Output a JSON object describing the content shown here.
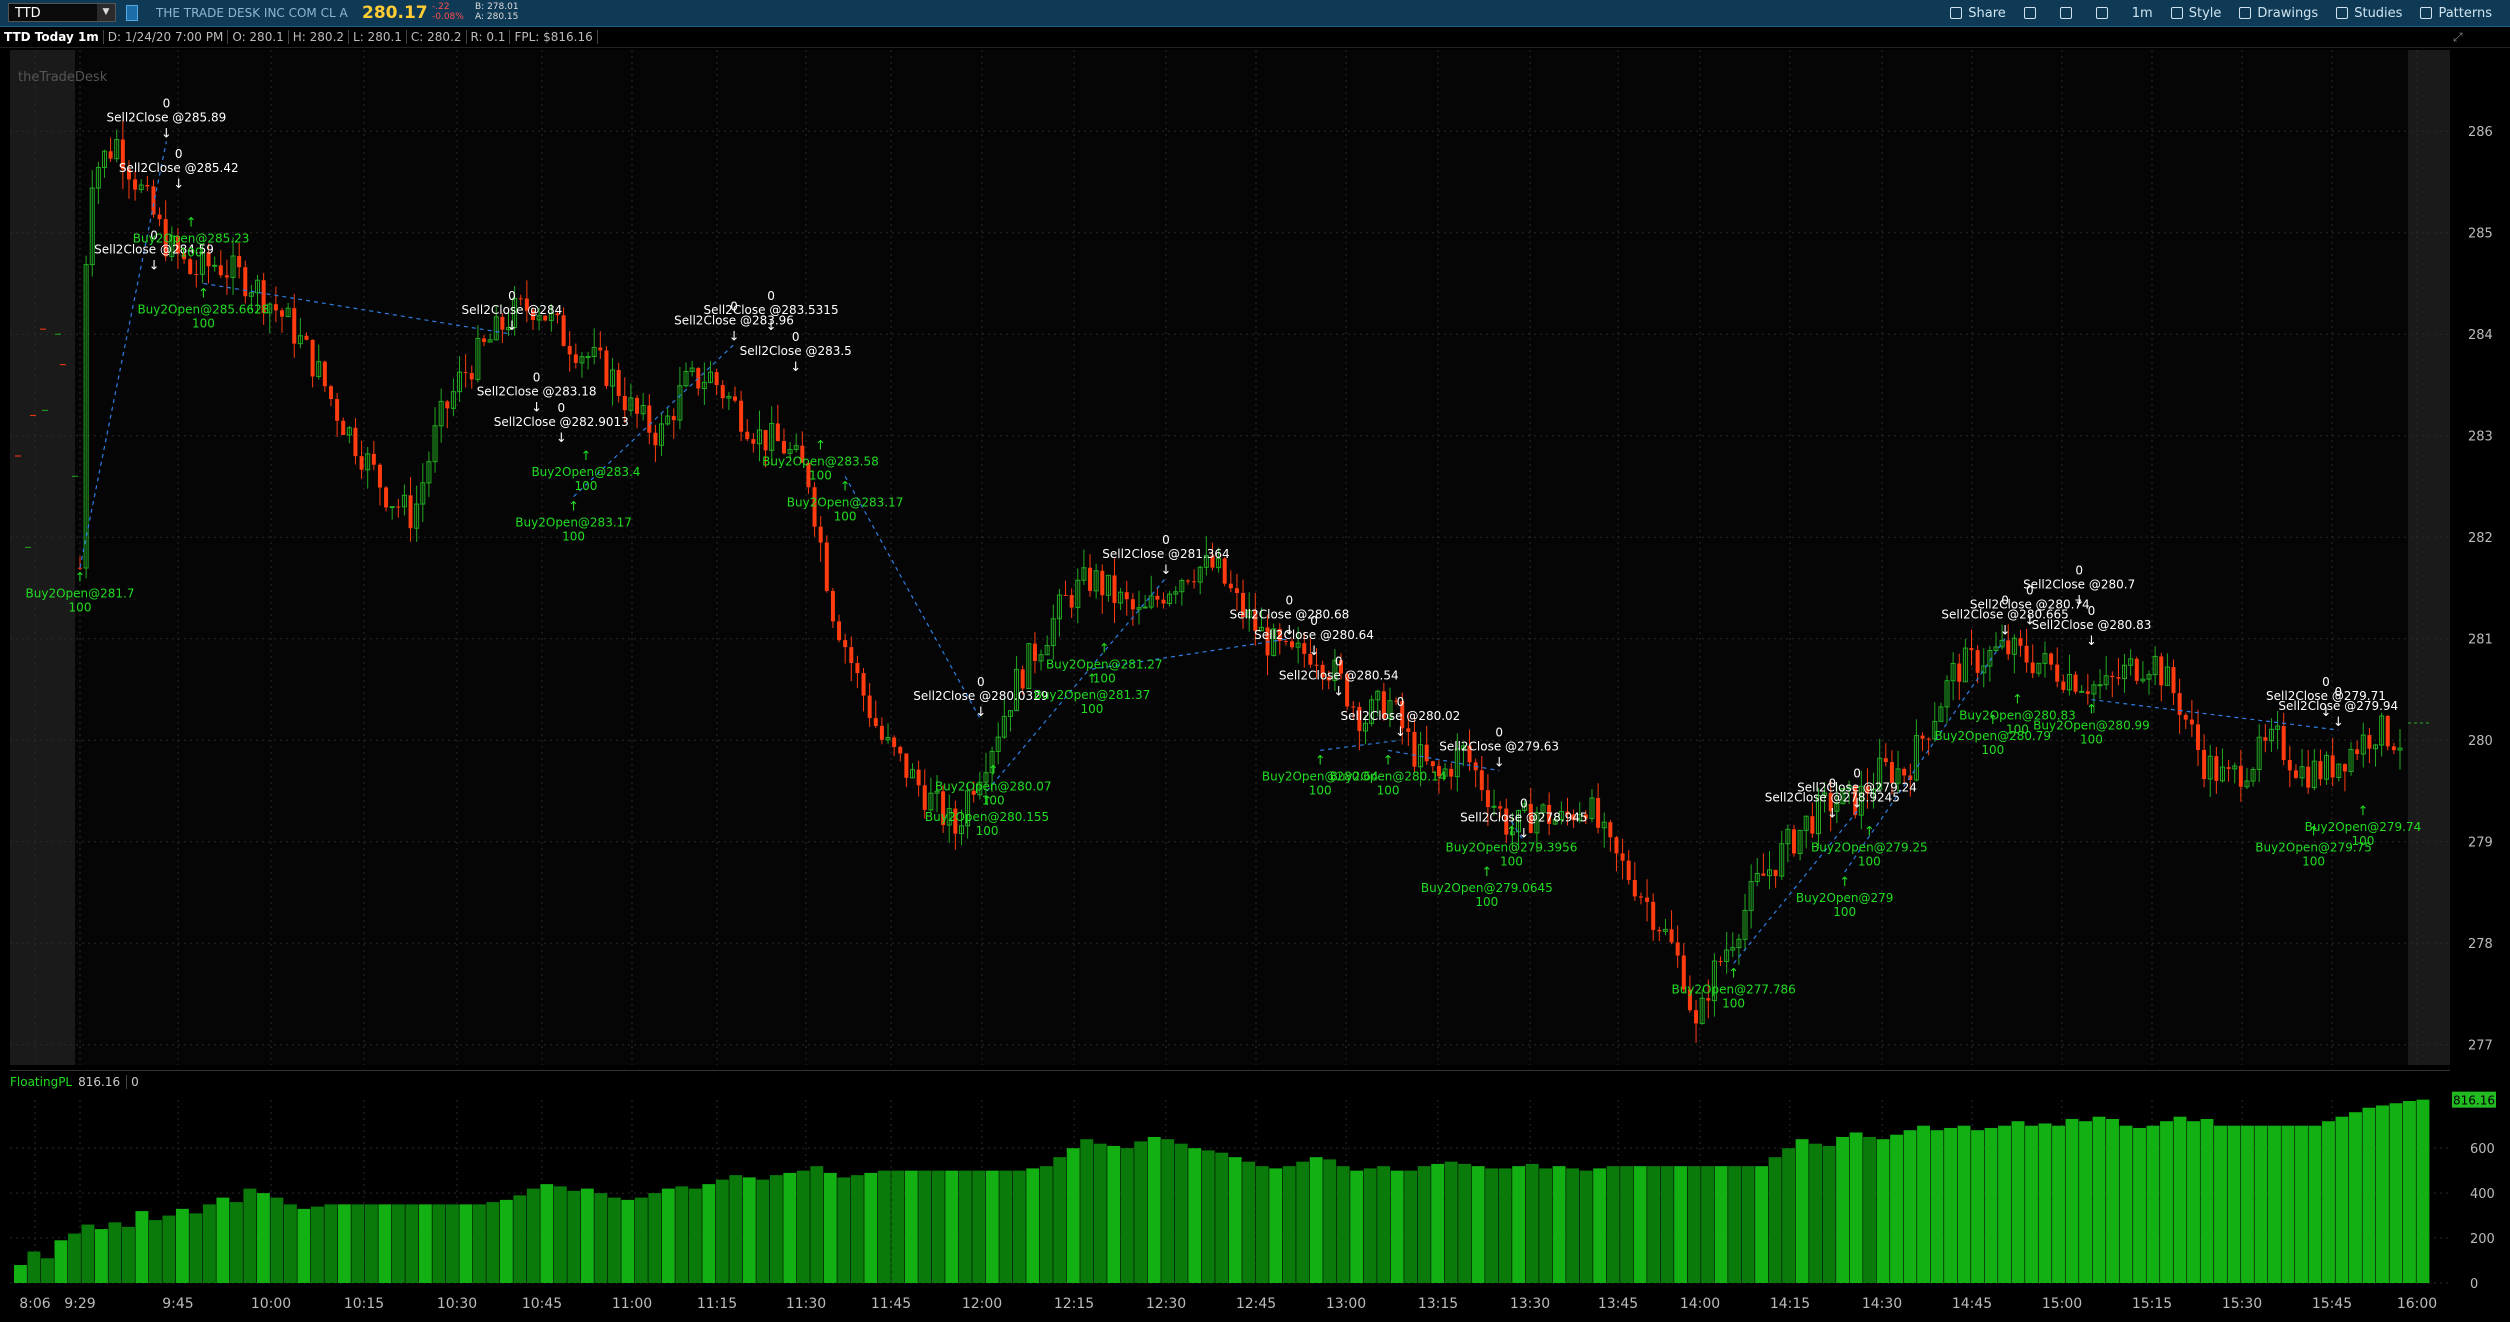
{
  "header": {
    "symbol": "TTD",
    "company": "THE TRADE DESK INC COM CL A",
    "last": "280.17",
    "change": "-.22",
    "change_pct": "-0.08%",
    "bid": "B: 278.01",
    "ask": "A: 280.15"
  },
  "toolbar": [
    {
      "label": "Share",
      "icon": "share-icon"
    },
    {
      "label": "",
      "icon": "camera-icon"
    },
    {
      "label": "",
      "icon": "flask-icon"
    },
    {
      "label": "",
      "icon": "gear-icon"
    },
    {
      "label": "1m",
      "icon": ""
    },
    {
      "label": "Style",
      "icon": "style-icon"
    },
    {
      "label": "Drawings",
      "icon": "drawings-icon"
    },
    {
      "label": "Studies",
      "icon": "studies-icon"
    },
    {
      "label": "Patterns",
      "icon": "patterns-icon"
    }
  ],
  "info": {
    "title": "TTD Today 1m",
    "date": "D: 1/24/20 7:00 PM",
    "open": "O: 280.1",
    "high": "H: 280.2",
    "low": "L: 280.1",
    "close": "C: 280.2",
    "range": "R: 0.1",
    "fpl": "FPL: $816.16"
  },
  "watermark": "theTradeDesk",
  "fpl_panel": {
    "name": "FloatingPL",
    "value": "816.16",
    "zero": "0"
  },
  "colors": {
    "up": "#22aa22",
    "down": "#ff3b10",
    "buy": "#22dd22",
    "sell": "#ffffff",
    "bar": "#0a7a0a"
  },
  "chart_data": [
    {
      "type": "candlestick",
      "title": "TTD Today 1m",
      "ylim": [
        276.8,
        286.8
      ],
      "price_ticks": [
        277,
        278,
        279,
        280,
        281,
        282,
        283,
        284,
        285,
        286
      ],
      "time_ticks": [
        "8:06",
        "9:29",
        "9:45",
        "10:00",
        "10:15",
        "10:30",
        "10:45",
        "11:00",
        "11:15",
        "11:30",
        "11:45",
        "12:00",
        "12:15",
        "12:30",
        "12:45",
        "13:00",
        "13:15",
        "13:30",
        "13:45",
        "14:00",
        "14:15",
        "14:30",
        "14:45",
        "15:00",
        "15:15",
        "15:30",
        "15:45",
        "16:00"
      ],
      "price_path": [
        [
          0,
          281.7
        ],
        [
          0.5,
          284.8
        ],
        [
          1,
          285.6
        ],
        [
          3,
          285.9
        ],
        [
          5,
          285.4
        ],
        [
          7,
          284.9
        ],
        [
          9,
          284.6
        ],
        [
          11,
          284.7
        ],
        [
          14,
          284.5
        ],
        [
          17,
          284.1
        ],
        [
          19,
          283.7
        ],
        [
          21,
          283.2
        ],
        [
          23,
          282.8
        ],
        [
          25,
          282.4
        ],
        [
          27,
          282.2
        ],
        [
          29,
          283.1
        ],
        [
          31,
          283.6
        ],
        [
          33,
          283.9
        ],
        [
          35,
          284.2
        ],
        [
          37,
          284.3
        ],
        [
          39,
          284.0
        ],
        [
          41,
          283.8
        ],
        [
          43,
          283.6
        ],
        [
          45,
          283.2
        ],
        [
          47,
          283.0
        ],
        [
          49,
          283.5
        ],
        [
          51,
          283.6
        ],
        [
          53,
          283.3
        ],
        [
          55,
          283.0
        ],
        [
          57,
          282.9
        ],
        [
          59,
          282.6
        ],
        [
          61,
          281.3
        ],
        [
          63,
          280.6
        ],
        [
          65,
          280.0
        ],
        [
          67,
          279.7
        ],
        [
          69,
          279.4
        ],
        [
          71,
          279.1
        ],
        [
          72,
          279.5
        ],
        [
          74,
          280.0
        ],
        [
          76,
          280.6
        ],
        [
          78,
          281.0
        ],
        [
          80,
          281.4
        ],
        [
          82,
          281.6
        ],
        [
          84,
          281.4
        ],
        [
          86,
          281.2
        ],
        [
          88,
          281.5
        ],
        [
          90,
          281.7
        ],
        [
          92,
          281.7
        ],
        [
          94,
          281.3
        ],
        [
          96,
          281.0
        ],
        [
          98,
          280.8
        ],
        [
          100,
          280.9
        ],
        [
          102,
          280.6
        ],
        [
          104,
          280.2
        ],
        [
          106,
          280.4
        ],
        [
          108,
          279.9
        ],
        [
          110,
          279.6
        ],
        [
          112,
          279.9
        ],
        [
          114,
          279.5
        ],
        [
          116,
          279.1
        ],
        [
          118,
          279.3
        ],
        [
          120,
          279.2
        ],
        [
          122,
          279.4
        ],
        [
          124,
          278.9
        ],
        [
          126,
          278.6
        ],
        [
          128,
          278.2
        ],
        [
          130,
          277.7
        ],
        [
          131,
          277.1
        ],
        [
          132,
          277.6
        ],
        [
          134,
          278.1
        ],
        [
          136,
          278.6
        ],
        [
          138,
          278.9
        ],
        [
          140,
          279.2
        ],
        [
          142,
          279.4
        ],
        [
          144,
          279.4
        ],
        [
          146,
          279.7
        ],
        [
          148,
          279.7
        ],
        [
          150,
          280.2
        ],
        [
          152,
          280.7
        ],
        [
          154,
          280.8
        ],
        [
          156,
          280.9
        ],
        [
          158,
          280.8
        ],
        [
          160,
          280.7
        ],
        [
          162,
          280.6
        ],
        [
          164,
          280.5
        ],
        [
          166,
          280.7
        ],
        [
          168,
          280.8
        ],
        [
          170,
          280.4
        ],
        [
          172,
          279.8
        ],
        [
          174,
          279.6
        ],
        [
          176,
          279.8
        ],
        [
          178,
          280.0
        ],
        [
          180,
          279.7
        ],
        [
          182,
          279.7
        ],
        [
          184,
          279.9
        ],
        [
          186,
          280.1
        ],
        [
          188,
          280.0
        ]
      ],
      "path_x_max": 188,
      "signals": [
        {
          "t": 0,
          "label": "Buy2Open@281.7",
          "qty": "100",
          "side": "buy",
          "p": 281.7
        },
        {
          "t": 7,
          "label": "Sell2Close @285.89",
          "qty": "0",
          "side": "sell",
          "p": 285.9
        },
        {
          "t": 8,
          "label": "Sell2Close @285.42",
          "qty": "0",
          "side": "sell",
          "p": 285.4
        },
        {
          "t": 6,
          "label": "Sell2Close @284.59",
          "qty": "0",
          "side": "sell",
          "p": 284.6
        },
        {
          "t": 9,
          "label": "Buy2Open@285.23",
          "qty": "100",
          "side": "buy",
          "p": 285.2
        },
        {
          "t": 10,
          "label": "Buy2Open@285.6628",
          "qty": "100",
          "side": "buy",
          "p": 284.5
        },
        {
          "t": 35,
          "label": "Sell2Close @284",
          "qty": "0",
          "side": "sell",
          "p": 284.0
        },
        {
          "t": 37,
          "label": "Sell2Close @283.18",
          "qty": "0",
          "side": "sell",
          "p": 283.2
        },
        {
          "t": 39,
          "label": "Sell2Close @282.9013",
          "qty": "0",
          "side": "sell",
          "p": 282.9
        },
        {
          "t": 41,
          "label": "Buy2Open@283.4",
          "qty": "100",
          "side": "buy",
          "p": 282.9
        },
        {
          "t": 40,
          "label": "Buy2Open@283.17",
          "qty": "100",
          "side": "buy",
          "p": 282.4
        },
        {
          "t": 53,
          "label": "Sell2Close @283.96",
          "qty": "0",
          "side": "sell",
          "p": 283.9
        },
        {
          "t": 56,
          "label": "Sell2Close @283.5315",
          "qty": "0",
          "side": "sell",
          "p": 284.0
        },
        {
          "t": 58,
          "label": "Sell2Close @283.5",
          "qty": "0",
          "side": "sell",
          "p": 283.6
        },
        {
          "t": 60,
          "label": "Buy2Open@283.58",
          "qty": "100",
          "side": "buy",
          "p": 283.0
        },
        {
          "t": 62,
          "label": "Buy2Open@283.17",
          "qty": "100",
          "side": "buy",
          "p": 282.6
        },
        {
          "t": 73,
          "label": "Sell2Close @280.0329",
          "qty": "0",
          "side": "sell",
          "p": 280.2
        },
        {
          "t": 74,
          "label": "Buy2Open@280.07",
          "qty": "100",
          "side": "buy",
          "p": 279.8
        },
        {
          "t": 73.5,
          "label": "Buy2Open@280.155",
          "qty": "100",
          "side": "buy",
          "p": 279.5
        },
        {
          "t": 88,
          "label": "Sell2Close @281.364",
          "qty": "0",
          "side": "sell",
          "p": 281.6
        },
        {
          "t": 83,
          "label": "Buy2Open@281.27",
          "qty": "100",
          "side": "buy",
          "p": 281.0
        },
        {
          "t": 82,
          "label": "Buy2Open@281.37",
          "qty": "100",
          "side": "buy",
          "p": 280.7
        },
        {
          "t": 98,
          "label": "Sell2Close @280.68",
          "qty": "0",
          "side": "sell",
          "p": 281.0
        },
        {
          "t": 100,
          "label": "Sell2Close @280.64",
          "qty": "0",
          "side": "sell",
          "p": 280.8
        },
        {
          "t": 102,
          "label": "Sell2Close @280.54",
          "qty": "0",
          "side": "sell",
          "p": 280.4
        },
        {
          "t": 100.5,
          "label": "Buy2Open@280.64",
          "qty": "100",
          "side": "buy",
          "p": 279.9
        },
        {
          "t": 107,
          "label": "Sell2Close @280.02",
          "qty": "0",
          "side": "sell",
          "p": 280.0
        },
        {
          "t": 106,
          "label": "Buy2Open@280.14",
          "qty": "100",
          "side": "buy",
          "p": 279.9
        },
        {
          "t": 115,
          "label": "Sell2Close @279.63",
          "qty": "0",
          "side": "sell",
          "p": 279.7
        },
        {
          "t": 116,
          "label": "Buy2Open@279.3956",
          "qty": "100",
          "side": "buy",
          "p": 279.2
        },
        {
          "t": 117,
          "label": "Sell2Close @278.945",
          "qty": "0",
          "side": "sell",
          "p": 279.0
        },
        {
          "t": 114,
          "label": "Buy2Open@279.0645",
          "qty": "100",
          "side": "buy",
          "p": 278.8
        },
        {
          "t": 134,
          "label": "Buy2Open@277.786",
          "qty": "100",
          "side": "buy",
          "p": 277.8
        },
        {
          "t": 144,
          "label": "Sell2Close @279.24",
          "qty": "0",
          "side": "sell",
          "p": 279.3
        },
        {
          "t": 142,
          "label": "Sell2Close @278.9245",
          "qty": "0",
          "side": "sell",
          "p": 279.2
        },
        {
          "t": 145,
          "label": "Buy2Open@279.25",
          "qty": "100",
          "side": "buy",
          "p": 279.2
        },
        {
          "t": 143,
          "label": "Buy2Open@279",
          "qty": "100",
          "side": "buy",
          "p": 278.7
        },
        {
          "t": 156,
          "label": "Sell2Close @280.665",
          "qty": "0",
          "side": "sell",
          "p": 281.0
        },
        {
          "t": 158,
          "label": "Sell2Close @280.74",
          "qty": "0",
          "side": "sell",
          "p": 281.1
        },
        {
          "t": 162,
          "label": "Sell2Close @280.7",
          "qty": "0",
          "side": "sell",
          "p": 281.3
        },
        {
          "t": 163,
          "label": "Sell2Close @280.83",
          "qty": "0",
          "side": "sell",
          "p": 280.9
        },
        {
          "t": 157,
          "label": "Buy2Open@280.83",
          "qty": "100",
          "side": "buy",
          "p": 280.5
        },
        {
          "t": 155,
          "label": "Buy2Open@280.79",
          "qty": "100",
          "side": "buy",
          "p": 280.3
        },
        {
          "t": 163,
          "label": "Buy2Open@280.99",
          "qty": "100",
          "side": "buy",
          "p": 280.4
        },
        {
          "t": 183,
          "label": "Sell2Close @279.94",
          "qty": "0",
          "side": "sell",
          "p": 280.1
        },
        {
          "t": 182,
          "label": "Sell2Close @279.71",
          "qty": "0",
          "side": "sell",
          "p": 280.2
        },
        {
          "t": 185,
          "label": "Buy2Open@279.74",
          "qty": "100",
          "side": "buy",
          "p": 279.4
        },
        {
          "t": 181,
          "label": "Buy2Open@279.75",
          "qty": "100",
          "side": "buy",
          "p": 279.2
        }
      ]
    },
    {
      "type": "bar",
      "title": "FloatingPL",
      "ylim": [
        0,
        850
      ],
      "y_ticks": [
        0,
        200,
        400,
        600
      ],
      "last_value": "816.16",
      "values": [
        80,
        140,
        110,
        190,
        220,
        260,
        240,
        270,
        250,
        320,
        280,
        300,
        330,
        310,
        350,
        380,
        360,
        420,
        400,
        380,
        350,
        330,
        340,
        350,
        350,
        350,
        350,
        350,
        350,
        350,
        350,
        350,
        350,
        350,
        350,
        360,
        370,
        390,
        420,
        440,
        430,
        410,
        420,
        400,
        380,
        370,
        380,
        400,
        420,
        430,
        420,
        440,
        460,
        480,
        470,
        460,
        480,
        490,
        500,
        520,
        490,
        470,
        480,
        490,
        500,
        500,
        500,
        500,
        500,
        500,
        500,
        500,
        500,
        500,
        500,
        510,
        520,
        560,
        600,
        640,
        620,
        610,
        600,
        630,
        650,
        640,
        620,
        600,
        590,
        580,
        560,
        540,
        520,
        510,
        520,
        540,
        560,
        550,
        520,
        500,
        510,
        520,
        500,
        500,
        520,
        530,
        540,
        530,
        520,
        510,
        510,
        520,
        530,
        510,
        520,
        510,
        500,
        510,
        520,
        520,
        520,
        520,
        520,
        520,
        520,
        520,
        520,
        520,
        520,
        520,
        560,
        600,
        640,
        620,
        610,
        650,
        670,
        650,
        640,
        660,
        680,
        700,
        680,
        690,
        700,
        680,
        690,
        700,
        720,
        700,
        710,
        700,
        730,
        720,
        740,
        730,
        700,
        690,
        700,
        720,
        740,
        720,
        730,
        700,
        700,
        700,
        700,
        700,
        700,
        700,
        700,
        720,
        740,
        760,
        780,
        790,
        800,
        810,
        816
      ]
    }
  ]
}
